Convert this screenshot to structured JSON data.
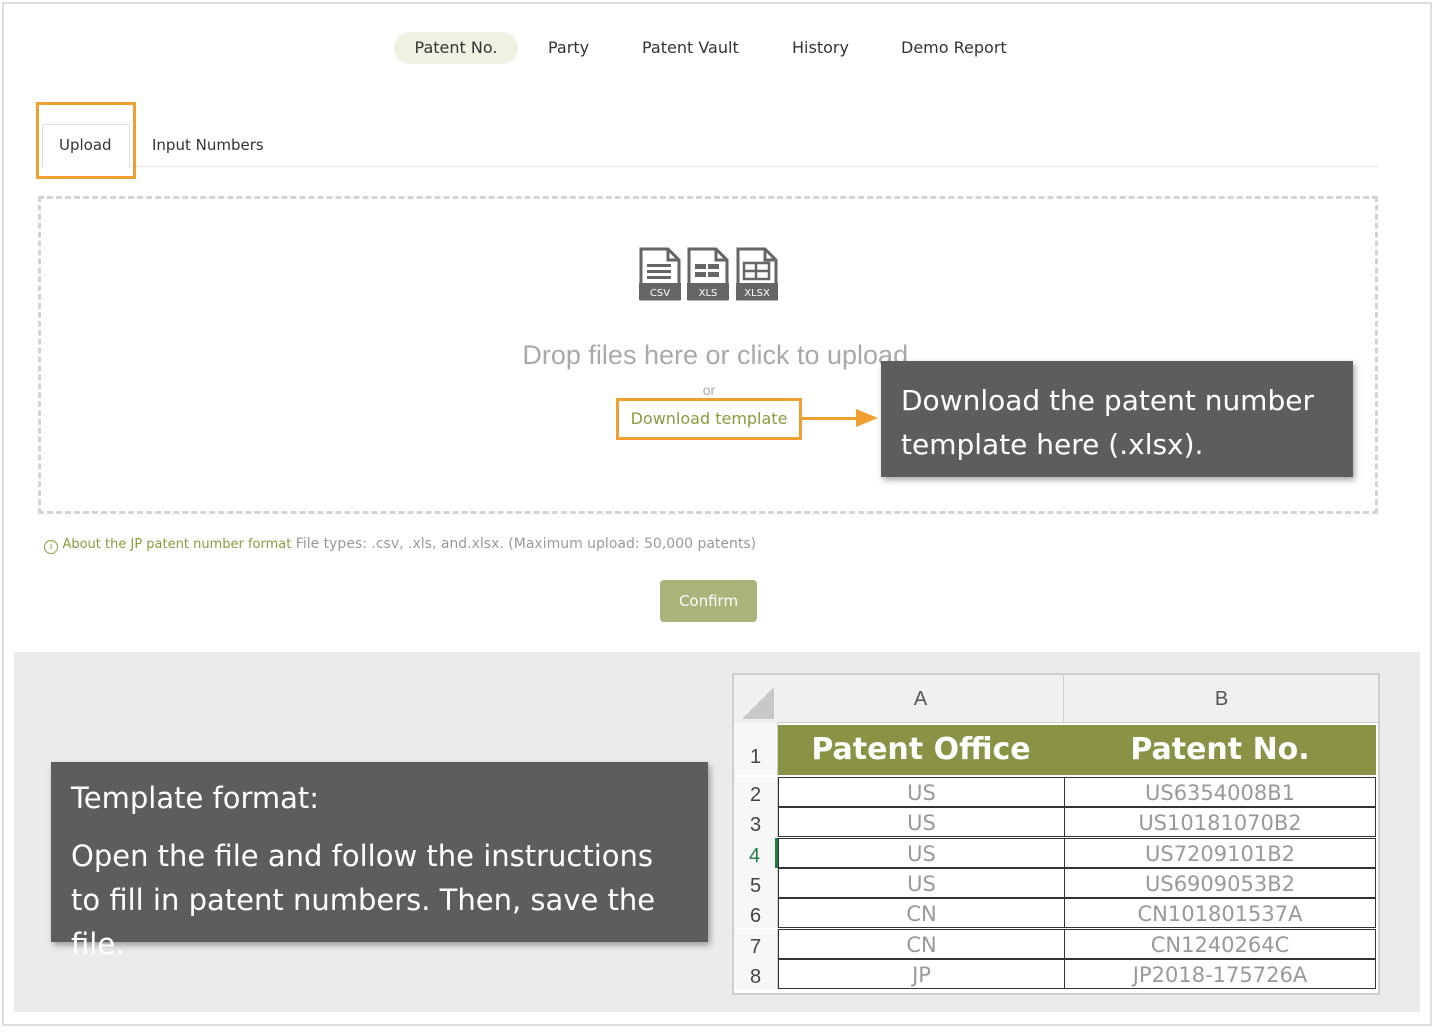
{
  "nav": {
    "items": [
      {
        "label": "Patent No.",
        "active": true
      },
      {
        "label": "Party"
      },
      {
        "label": "Patent Vault"
      },
      {
        "label": "History"
      },
      {
        "label": "Demo Report"
      }
    ]
  },
  "tabs": {
    "upload": "Upload",
    "input_numbers": "Input Numbers"
  },
  "upload": {
    "file_icons": [
      "CSV",
      "XLS",
      "XLSX"
    ],
    "drop_text": "Drop files here or click to upload.",
    "or_text": "or",
    "download_template": "Download template",
    "jp_format_link": "About the JP patent number format",
    "file_types_hint": "File types: .csv, .xls, and.xlsx. (Maximum upload: 50,000 patents)",
    "confirm_label": "Confirm"
  },
  "callouts": {
    "download": "Download the patent number template here (.xlsx).",
    "template_title": "Template format:",
    "template_body": "Open the file and follow the instructions to fill in patent numbers. Then, save the file."
  },
  "spreadsheet": {
    "columns": [
      "A",
      "B"
    ],
    "header_row": {
      "num": "1",
      "cells": [
        "Patent Office",
        "Patent No."
      ]
    },
    "rows": [
      {
        "num": "2",
        "cells": [
          "US",
          "US6354008B1"
        ]
      },
      {
        "num": "3",
        "cells": [
          "US",
          "US10181070B2"
        ]
      },
      {
        "num": "4",
        "cells": [
          "US",
          "US7209101B2"
        ]
      },
      {
        "num": "5",
        "cells": [
          "US",
          "US6909053B2"
        ]
      },
      {
        "num": "6",
        "cells": [
          "CN",
          "CN101801537A"
        ]
      },
      {
        "num": "7",
        "cells": [
          "CN",
          "CN1240264C"
        ]
      },
      {
        "num": "8",
        "cells": [
          "JP",
          "JP2018-175726A"
        ]
      }
    ],
    "selected_row": "4",
    "header_color": "#8a9345"
  },
  "colors": {
    "accent_orange": "#f0a030",
    "brand_green": "#8a9a3e",
    "confirm_bg": "#aab47a",
    "callout_bg": "#5d5d5d"
  }
}
